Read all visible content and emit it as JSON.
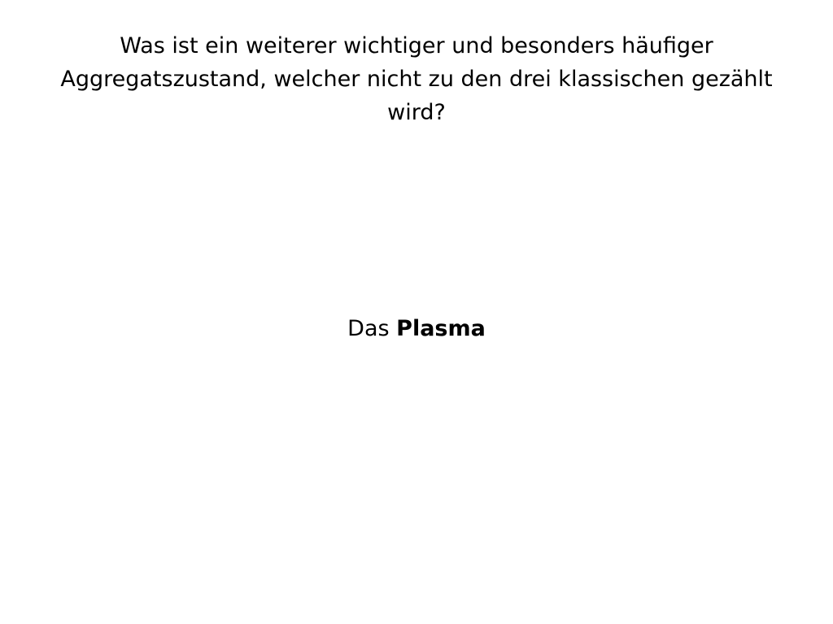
{
  "card": {
    "question": "Was ist ein weiterer wichtiger und besonders häufiger Aggregatszustand, welcher nicht zu den drei klassischen gezählt wird?",
    "answer": {
      "prefix": "Das ",
      "term": "Plasma"
    }
  }
}
